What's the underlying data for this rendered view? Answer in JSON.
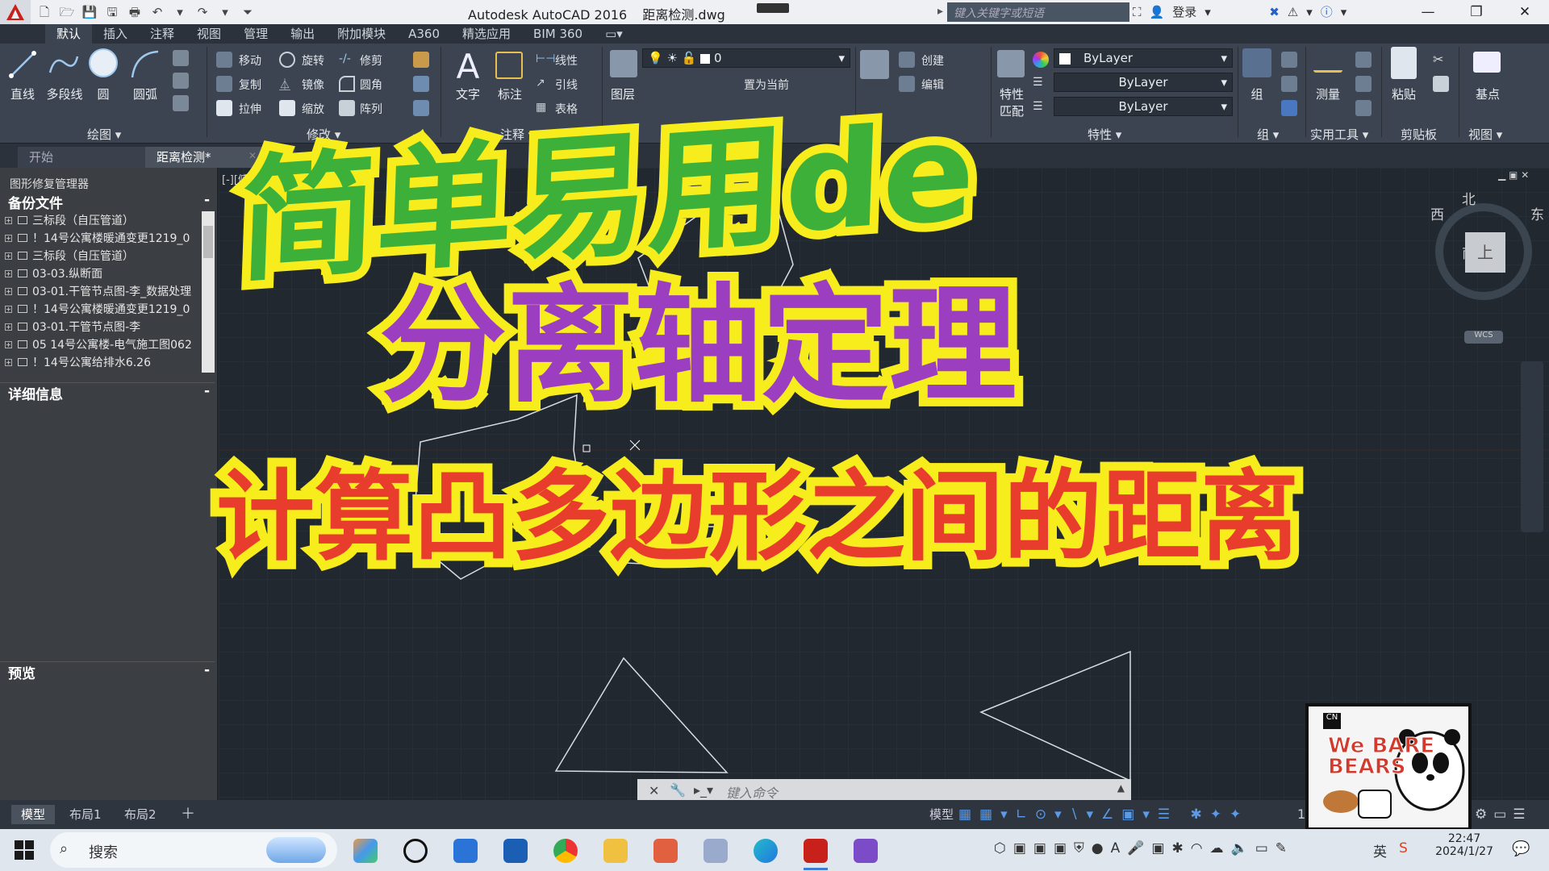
{
  "titlebar": {
    "app_title": "Autodesk AutoCAD 2016",
    "file_name": "距离检测.dwg",
    "search_placeholder": "键入关键字或短语",
    "login_label": "登录"
  },
  "ribbon_tabs": [
    "默认",
    "插入",
    "注释",
    "视图",
    "管理",
    "输出",
    "附加模块",
    "A360",
    "精选应用",
    "BIM 360"
  ],
  "ribbon": {
    "draw": {
      "line": "直线",
      "polyline": "多段线",
      "circle": "圆",
      "arc": "圆弧",
      "panel": "绘图 ▾"
    },
    "modify": {
      "move": "移动",
      "rotate": "旋转",
      "trim": "修剪",
      "copy": "复制",
      "mirror": "镜像",
      "fillet": "圆角",
      "stretch": "拉伸",
      "scale": "缩放",
      "array": "阵列",
      "panel": "修改 ▾"
    },
    "annotation": {
      "text": "文字",
      "dimension": "标注",
      "linear": "线性",
      "leader": "引线",
      "table": "表格",
      "panel": "注释 ▾"
    },
    "layers": {
      "layer_props": "图层",
      "layer_value": "0",
      "set_current": "置为当前",
      "panel_label": "图层"
    },
    "block": {
      "create": "创建",
      "edit": "编辑"
    },
    "properties": {
      "match": "特性",
      "match2": "匹配",
      "color": "ByLayer",
      "linetype": "ByLayer",
      "lineweight": "ByLayer",
      "panel": "特性 ▾"
    },
    "groups": {
      "group": "组",
      "panel": "组 ▾"
    },
    "utilities": {
      "measure": "测量",
      "panel": "实用工具 ▾"
    },
    "clipboard": {
      "paste": "粘贴",
      "panel": "剪贴板"
    },
    "view": {
      "base": "基点",
      "panel": "视图 ▾"
    }
  },
  "doc_tabs": [
    "开始",
    "距离检测*"
  ],
  "left_panel": {
    "title": "图形修复管理器",
    "backup_header": "备份文件",
    "files": [
      "三标段（自压管道）",
      "！14号公寓楼暖通变更1219_0",
      "三标段（自压管道）",
      "03-03.纵断面",
      "03-01.干管节点图-李_数据处理",
      "！14号公寓楼暖通变更1219_0",
      "03-01.干管节点图-李",
      "05 14号公寓楼-电气施工图062",
      "！14号公寓给排水6.26"
    ],
    "details_header": "详细信息",
    "preview_header": "预览"
  },
  "viewcube": {
    "north": "北",
    "south": "南",
    "east": "东",
    "west": "西",
    "top": "上",
    "wcs": "WCS"
  },
  "viewport_label": "[-][俯",
  "command": {
    "placeholder": "键入命令"
  },
  "layout_tabs": [
    "模型",
    "布局1",
    "布局2"
  ],
  "status": {
    "model": "模型",
    "scale": "1:"
  },
  "taskbar": {
    "search": "搜索",
    "time": "22:47",
    "date": "2024/1/27",
    "ime": "英"
  },
  "overlay": {
    "line1": "简单易用de",
    "line2": "分离轴定理",
    "line3": "计算凸多边形之间的距离"
  },
  "sticker": {
    "brand": "We BARE BEARS",
    "cn": "CN"
  },
  "colors": {
    "green": "#3db03a",
    "purple": "#9b3fc0",
    "red": "#e83c2c",
    "yellow_stroke": "#f7ec1c",
    "canvas": "#212830"
  }
}
